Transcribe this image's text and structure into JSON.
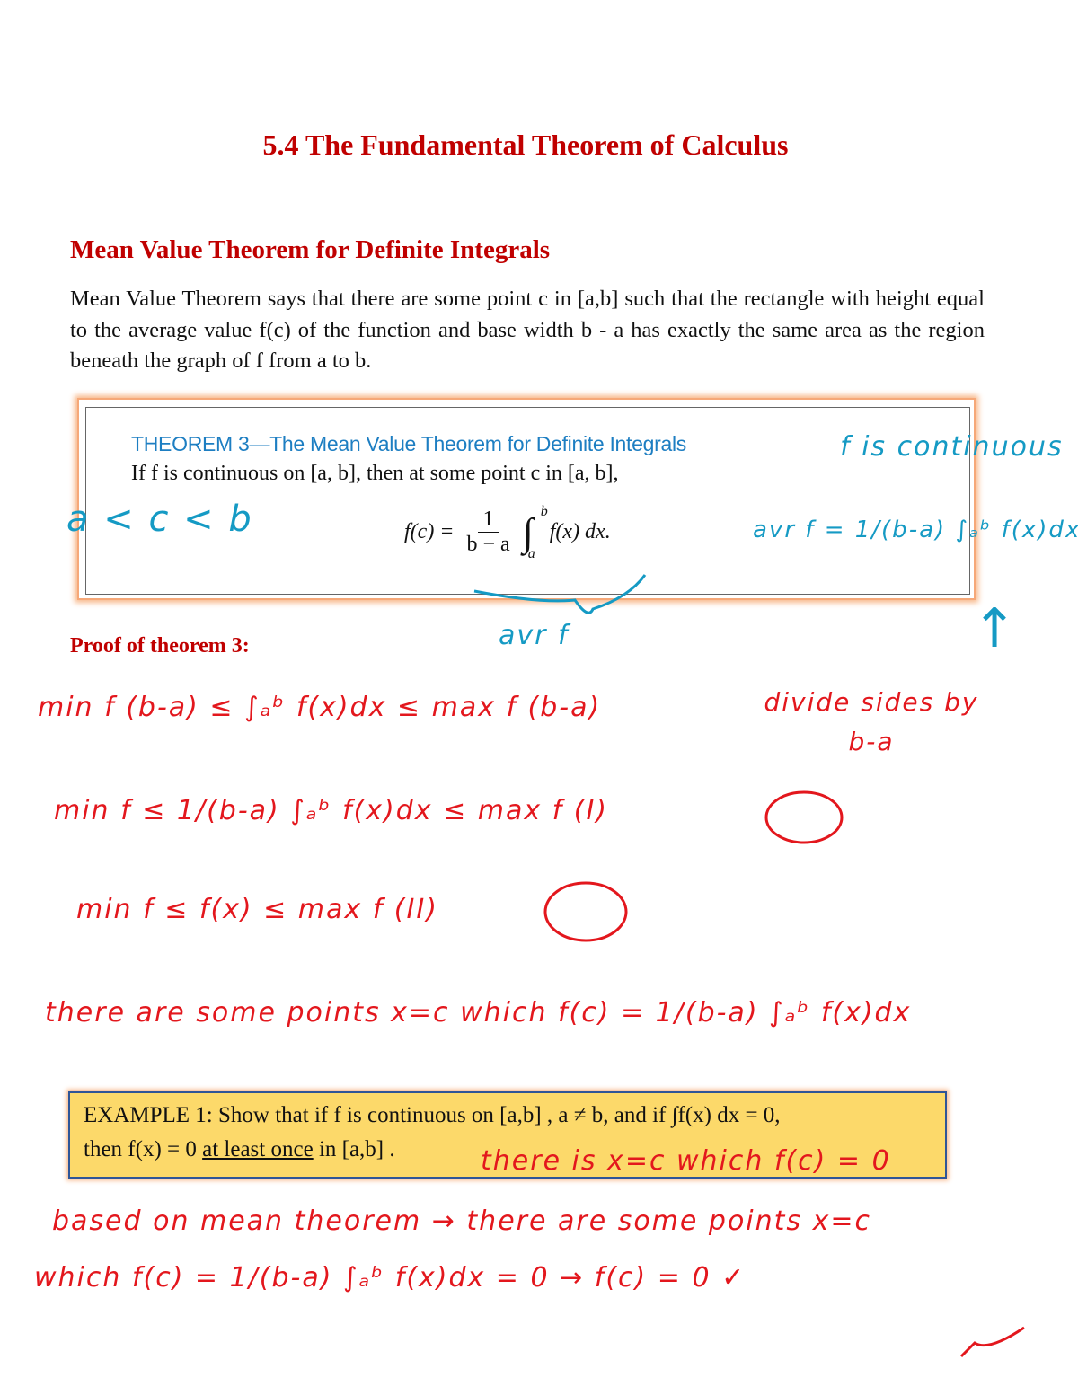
{
  "title": "5.4 The Fundamental Theorem of Calculus",
  "section": {
    "heading": "Mean Value Theorem for Definite Integrals",
    "intro": "Mean Value Theorem says that there are some point c in [a,b] such that the rectangle with height equal to the average value f(c) of the function and base width b - a has exactly the same area as the region beneath the graph of f from a to b."
  },
  "theorem": {
    "title": "THEOREM 3—The Mean Value Theorem for Definite Integrals",
    "statement": "If f is continuous on [a, b], then at some point c in [a, b],",
    "formula_lhs": "f(c) =",
    "formula_num": "1",
    "formula_den": "b − a",
    "formula_upper": "b",
    "formula_lower": "a",
    "formula_integrand": "f(x) dx."
  },
  "proof_heading": "Proof of theorem 3:",
  "example": {
    "line1": "EXAMPLE 1: Show that if f is continuous on [a,b] , a ≠ b, and if ∫f(x) dx  =  0,",
    "line2_prefix": "then f(x) = 0 ",
    "line2_underlined": "at least once",
    "line2_suffix": " in [a,b] ."
  },
  "handwriting": {
    "blue": [
      "a < c < b",
      "f is continuous",
      "avr f = 1/(b-a) ∫ₐᵇ f(x)dx",
      "avr f",
      "↑"
    ],
    "red": [
      "min f (b-a) ≤ ∫ₐᵇ f(x)dx ≤ max f (b-a)",
      "divide sides by b-a",
      "min f ≤ 1/(b-a) ∫ₐᵇ f(x)dx ≤ max f   (I)",
      "min f ≤ f(x) ≤ max f   (II)",
      "there are some points x=c which f(c) = 1/(b-a) ∫ₐᵇ f(x)dx",
      "there is x=c which f(c) = 0",
      "based on mean theorem → there are some points x=c",
      "which f(c) = 1/(b-a) ∫ₐᵇ f(x)dx = 0  →  f(c) = 0  ✓"
    ]
  },
  "colors": {
    "heading": "#c00000",
    "theorem_title": "#1d7ec2",
    "ink_red": "#e3171d",
    "ink_blue": "#159ac4",
    "example_bg": "#fcd96a",
    "example_border": "#2f5597"
  }
}
